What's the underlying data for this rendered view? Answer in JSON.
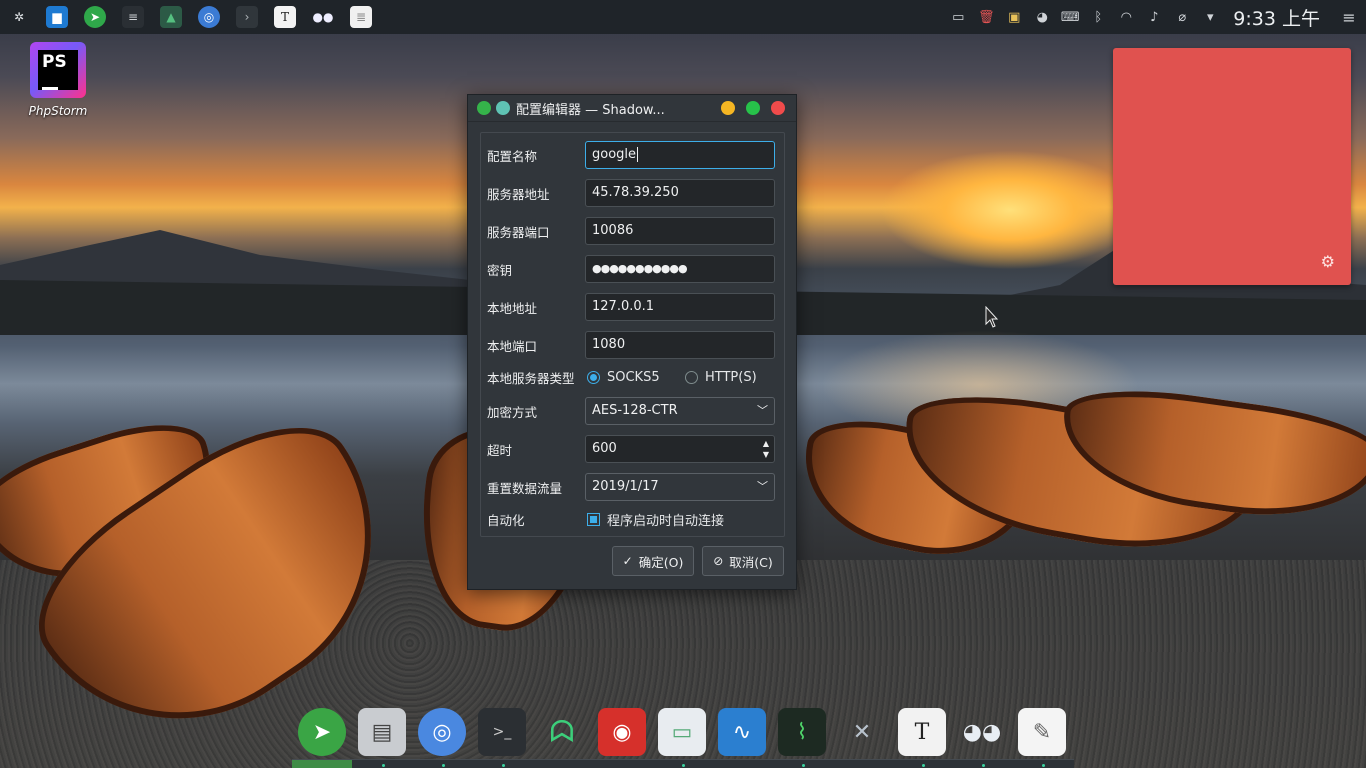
{
  "desktop": {
    "icon_label": "PhpStorm",
    "icon_logo_text": "PS"
  },
  "panel": {
    "clock": "9:33 上午",
    "tasks": [
      "kde-menu-icon",
      "file-manager-icon",
      "telegram-icon",
      "terminal-icon",
      "system-monitor-icon",
      "chromium-icon",
      "console-icon",
      "typora-icon",
      "wechat-icon",
      "notes-icon"
    ],
    "tray": [
      "window-icon",
      "trash-icon",
      "image-icon",
      "wechat-icon",
      "keyboard-icon",
      "bluetooth-icon",
      "wifi-icon",
      "volume-icon",
      "clip-icon",
      "expand-icon"
    ]
  },
  "dialog": {
    "title": "配置编辑器 — Shadow...",
    "fields": {
      "name_label": "配置名称",
      "name_value": "google",
      "server_label": "服务器地址",
      "server_value": "45.78.39.250",
      "port_label": "服务器端口",
      "port_value": "10086",
      "password_label": "密钥",
      "password_value": "●●●●●●●●●●●",
      "local_addr_label": "本地地址",
      "local_addr_value": "127.0.0.1",
      "local_port_label": "本地端口",
      "local_port_value": "1080",
      "local_type_label": "本地服务器类型",
      "type_socks": "SOCKS5",
      "type_http": "HTTP(S)",
      "encrypt_label": "加密方式",
      "encrypt_value": "AES-128-CTR",
      "timeout_label": "超时",
      "timeout_value": "600",
      "reset_label": "重置数据流量",
      "reset_value": "2019/1/17",
      "auto_label": "自动化",
      "auto_value": "程序启动时自动连接"
    },
    "ok_label": "确定(O)",
    "cancel_label": "取消(C)"
  },
  "dock": {
    "items": [
      "shadowsocks-icon",
      "file-cabinet-icon",
      "chromium-icon",
      "terminal-icon",
      "ghost-icon",
      "netease-music-icon",
      "window-manager-icon",
      "wave-monitor-icon",
      "system-monitor-icon",
      "tools-icon",
      "typora-icon",
      "wechat-icon",
      "text-editor-icon"
    ]
  },
  "colors": {
    "accent": "#3daee9",
    "note": "#e0524f",
    "close": "#f04b4b",
    "minimize": "#f5b623",
    "maximize": "#27c24a"
  }
}
